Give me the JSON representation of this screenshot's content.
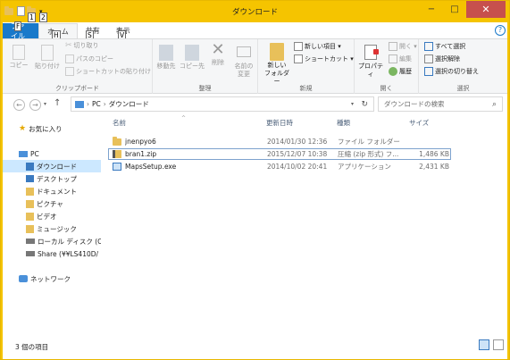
{
  "window": {
    "title": "ダウンロード",
    "accent": "#f5c400",
    "controls": {
      "minimize": "−",
      "maximize": "□",
      "close": "✕"
    }
  },
  "keytips": {
    "qat1": "1",
    "qat2": "2",
    "file": "F",
    "home": "H",
    "share": "S",
    "view": "V"
  },
  "tabs": {
    "file": "ファイル",
    "home": "ホーム",
    "share": "共有",
    "view": "表示",
    "help": "?"
  },
  "ribbon": {
    "clipboard": {
      "label": "クリップボード",
      "copy": "コピー",
      "paste": "貼り付け",
      "cut": "切り取り",
      "copy_path": "パスのコピー",
      "paste_shortcut": "ショートカットの貼り付け"
    },
    "organize": {
      "label": "整理",
      "move_to": "移動先",
      "copy_to": "コピー先",
      "delete": "削除",
      "rename_line1": "名前の",
      "rename_line2": "変更"
    },
    "new": {
      "label": "新規",
      "new_folder_line1": "新しい",
      "new_folder_line2": "フォルダー",
      "new_item": "新しい項目 ▾",
      "shortcut": "ショートカット ▾"
    },
    "open": {
      "label": "開く",
      "properties": "プロパティ",
      "open": "開く ▾",
      "edit": "編集",
      "history": "履歴"
    },
    "select": {
      "label": "選択",
      "select_all": "すべて選択",
      "select_none": "選択解除",
      "invert": "選択の切り替え"
    }
  },
  "address": {
    "back": "←",
    "forward": "→",
    "up": "↑",
    "path": [
      "PC",
      "ダウンロード"
    ],
    "refresh": "↻",
    "search_placeholder": "ダウンロードの検索"
  },
  "nav": {
    "favorites": "お気に入り",
    "pc": "PC",
    "items": [
      "ダウンロード",
      "デスクトップ",
      "ドキュメント",
      "ピクチャ",
      "ビデオ",
      "ミュージック",
      "ローカル ディスク (C:)",
      "Share (¥¥LS410D/"
    ],
    "network": "ネットワーク"
  },
  "columns": {
    "name": "名前",
    "modified": "更新日時",
    "type": "種類",
    "size": "サイズ"
  },
  "files": [
    {
      "name": "jnenpyo6",
      "modified": "2014/01/30 12:36",
      "type": "ファイル フォルダー",
      "size": ""
    },
    {
      "name": "bran1.zip",
      "modified": "2015/12/07 10:38",
      "type": "圧縮 (zip 形式) フ...",
      "size": "1,486 KB"
    },
    {
      "name": "MapsSetup.exe",
      "modified": "2014/10/02 20:41",
      "type": "アプリケーション",
      "size": "2,431 KB"
    }
  ],
  "status": {
    "count": "3 個の項目"
  }
}
